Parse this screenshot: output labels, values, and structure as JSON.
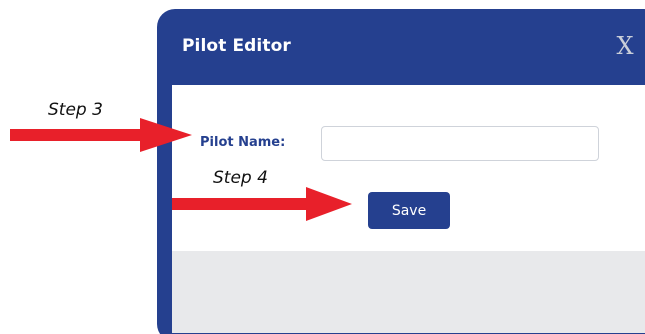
{
  "dialog": {
    "title": "Pilot Editor",
    "close_label": "X"
  },
  "form": {
    "pilot_name_label": "Pilot Name:",
    "pilot_name_value": "",
    "save_label": "Save"
  },
  "annotations": {
    "step3_label": "Step 3",
    "step4_label": "Step 4",
    "arrow_color": "#e8202a"
  },
  "colors": {
    "dialog_header": "#25408f",
    "body_background": "#ffffff",
    "footer_background": "#e8e9eb",
    "label_text": "#25408f",
    "save_button": "#25408f"
  }
}
